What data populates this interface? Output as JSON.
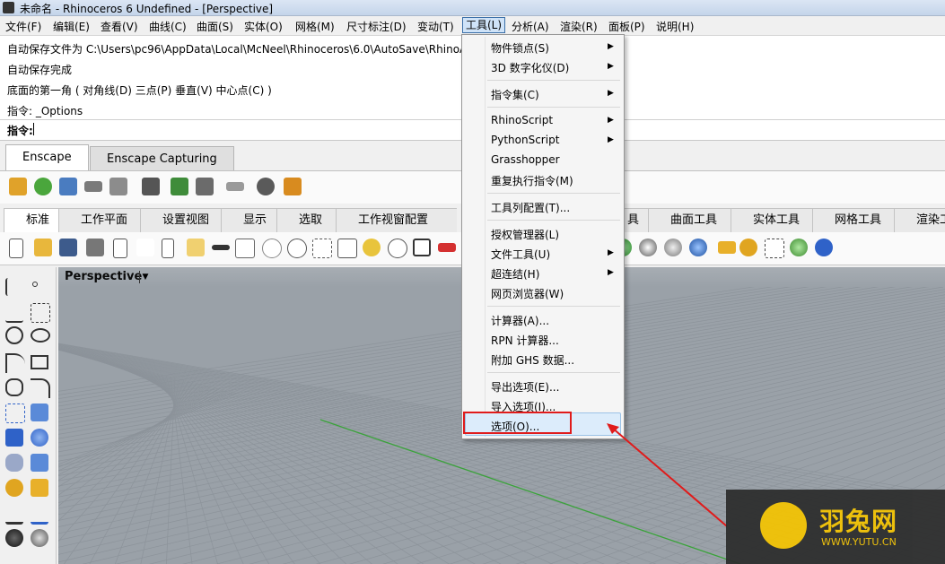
{
  "window": {
    "title": "未命名 - Rhinoceros 6 Undefined - [Perspective]"
  },
  "menubar": {
    "items": [
      "文件(F)",
      "编辑(E)",
      "查看(V)",
      "曲线(C)",
      "曲面(S)",
      "实体(O)",
      "网格(M)",
      "尺寸标注(D)",
      "变动(T)",
      "工具(L)",
      "分析(A)",
      "渲染(R)",
      "面板(P)",
      "说明(H)"
    ],
    "active": "工具(L)"
  },
  "command_history": [
    "自动保存文件为 C:\\Users\\pc96\\AppData\\Local\\McNeel\\Rhinoceros\\6.0\\AutoSave\\RhinoA",
    "自动保存完成",
    "底面的第一角 ( 对角线(D)  三点(P)  垂直(V)  中心点(C) )",
    "指令: _Options"
  ],
  "command_prompt": "指令:",
  "enscape_tabs": [
    "Enscape",
    "Enscape Capturing"
  ],
  "main_tabs": [
    "标准",
    "工作平面",
    "设置视图",
    "显示",
    "选取",
    "工作视窗配置",
    "具",
    "曲面工具",
    "实体工具",
    "网格工具",
    "渲染工"
  ],
  "viewport": {
    "name": "Perspective",
    "dropdown_glyph": "▼"
  },
  "tools_menu": {
    "groups": [
      [
        {
          "label": "物件锁点(S)",
          "submenu": true
        },
        {
          "label": "3D 数字化仪(D)",
          "submenu": true
        }
      ],
      [
        {
          "label": "指令集(C)",
          "submenu": true
        }
      ],
      [
        {
          "label": "RhinoScript",
          "submenu": true
        },
        {
          "label": "PythonScript",
          "submenu": true
        },
        {
          "label": "Grasshopper",
          "submenu": false
        },
        {
          "label": "重复执行指令(M)",
          "submenu": false
        }
      ],
      [
        {
          "label": "工具列配置(T)...",
          "submenu": false
        }
      ],
      [
        {
          "label": "授权管理器(L)",
          "submenu": false
        },
        {
          "label": "文件工具(U)",
          "submenu": true
        },
        {
          "label": "超连结(H)",
          "submenu": true
        },
        {
          "label": "网页浏览器(W)",
          "submenu": false
        }
      ],
      [
        {
          "label": "计算器(A)...",
          "submenu": false
        },
        {
          "label": "RPN 计算器...",
          "submenu": false
        },
        {
          "label": "附加 GHS 数据...",
          "submenu": false
        }
      ],
      [
        {
          "label": "导出选项(E)...",
          "submenu": false
        },
        {
          "label": "导入选项(I)...",
          "submenu": false
        },
        {
          "label": "选项(O)...",
          "submenu": false
        }
      ]
    ],
    "arrow_glyph": "▶"
  },
  "watermark": {
    "brand": "羽兔网",
    "url": "WWW.YUTU.CN"
  },
  "colors": {
    "highlight_box": "#e01b1b",
    "annotation_arrow": "#e01b1b",
    "grid_axis_x": "#c43b3b",
    "grid_axis_y": "#3aa33a",
    "watermark_accent": "#f5c400"
  }
}
